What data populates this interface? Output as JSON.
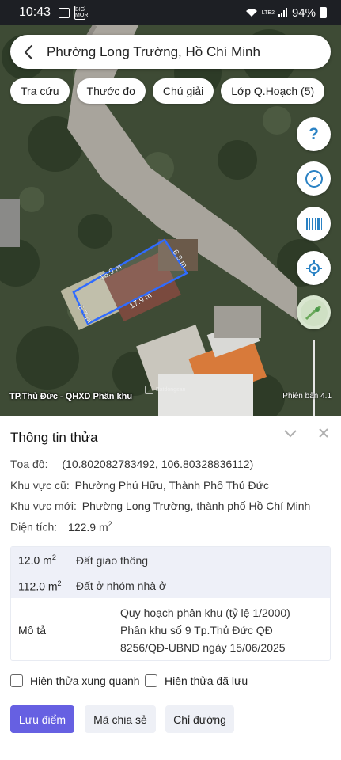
{
  "status_bar": {
    "time": "10:43",
    "indicator": "BIG MOR",
    "network": "LTE2",
    "battery": "94%"
  },
  "search": {
    "title": "Phường Long Trường, Hồ Chí Minh"
  },
  "chips": [
    {
      "label": "Tra cứu"
    },
    {
      "label": "Thước đo"
    },
    {
      "label": "Chú giải"
    },
    {
      "label": "Lớp Q.Hoạch (5)"
    }
  ],
  "map": {
    "dimensions": {
      "top": "15.9 m",
      "right": "6.8 m",
      "bottom": "17.9 m",
      "left": "6.7 m"
    },
    "watermark": "Batdongsan",
    "label_left": "TP.Thủ Đức - QHXD Phân khu",
    "label_right": "Phiên bản 4.1",
    "help_glyph": "?"
  },
  "panel": {
    "title": "Thông tin thửa",
    "coord_label": "Tọa độ:",
    "coord_value": "(10.802082783492, 106.80328836112)",
    "old_area_label": "Khu vực cũ:",
    "old_area_value": "Phường Phú Hữu, Thành Phố Thủ Đức",
    "new_area_label": "Khu vực mới:",
    "new_area_value": "Phường Long Trường, thành phố Hồ Chí Minh",
    "area_label": "Diện tích:",
    "area_value": "122.9 m",
    "area_unit_sup": "2",
    "landuse": [
      {
        "area": "12.0 m",
        "sup": "2",
        "type": "Đất giao thông"
      },
      {
        "area": "112.0 m",
        "sup": "2",
        "type": "Đất ở nhóm nhà ở"
      }
    ],
    "description_label": "Mô tả",
    "description": "Quy hoạch phân khu (tỷ lệ 1/2000) Phân khu số 9 Tp.Thủ Đức QĐ 8256/QĐ-UBND ngày 15/06/2025",
    "checkbox_nearby": "Hiện thửa xung quanh",
    "checkbox_saved": "Hiện thửa đã lưu",
    "buttons": {
      "save": "Lưu điểm",
      "share": "Mã chia sẻ",
      "directions": "Chỉ đường"
    }
  },
  "colors": {
    "accent": "#6660e2",
    "parcel_outline": "#2f6bff",
    "fab_icon": "#2a82c4"
  }
}
